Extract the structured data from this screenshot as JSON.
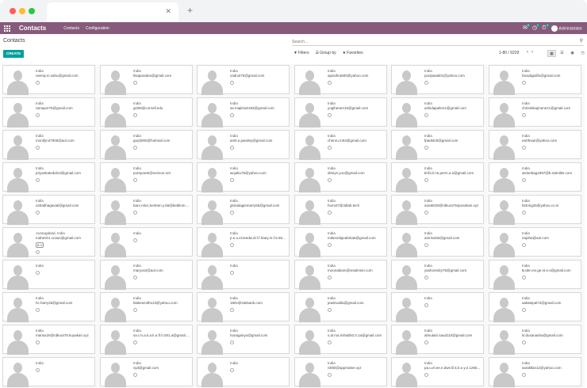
{
  "browser": {
    "tab_close_icon": "close-icon",
    "new_tab_icon": "plus-icon"
  },
  "navbar": {
    "app_title": "Contacts",
    "menu": [
      "Contacts",
      "Configuration"
    ],
    "chat_count": "6",
    "activity_count": "1",
    "timer_count": "4",
    "user": "Administrator",
    "accent": "#875a7b"
  },
  "control_panel": {
    "breadcrumb": "Contacts",
    "search_placeholder": "Search...",
    "create_label": "CREATE",
    "filters_label": "Filters",
    "group_by_label": "Group by",
    "favorites_label": "Favorites",
    "pager": "1-80 / 9229",
    "accent": "#00a09d"
  },
  "cards": [
    [
      {
        "country": "India",
        "email": "neeraj.m.sahu@gmail.com"
      },
      {
        "country": "India",
        "email": "lisaparades@gmail.com"
      },
      {
        "country": "India",
        "email": "vadnol75@gmail.com"
      },
      {
        "country": "India",
        "email": "apasihra500@yahoo.com"
      },
      {
        "country": "India",
        "email": "puripawal01@yahoo.com"
      },
      {
        "country": "India",
        "email": "facadqpdifo@gmail.com"
      }
    ],
    [
      {
        "country": "India",
        "email": "ramayer75@gmail.com"
      },
      {
        "country": "India",
        "email": "gsl39@cornell.edu"
      },
      {
        "country": "India",
        "email": "as.majitria0183@gmail.com"
      },
      {
        "country": "India",
        "email": "yogiheram15@gmail.com"
      },
      {
        "country": "India",
        "email": "ashidajaekm1@gmail.com"
      },
      {
        "country": "India",
        "email": "christiekajmenez1@gmail.com"
      }
    ],
    [
      {
        "country": "India",
        "email": "monifyn47000@aol.com"
      },
      {
        "country": "India",
        "email": "gurj3000@hotmail.com"
      },
      {
        "country": "India",
        "email": "amit.e.pandey@gmail.com"
      },
      {
        "country": "India",
        "email": "chenru.m04@gmail.com"
      },
      {
        "country": "India",
        "email": "fpadstri0@gmail.com"
      },
      {
        "country": "India",
        "email": "earthsair@yahoo.com"
      }
    ],
    [
      {
        "country": "India",
        "email": "priyankatedal13@gmail.com"
      },
      {
        "country": "India",
        "email": "purepoete@verizon.net"
      },
      {
        "country": "India",
        "email": "wcjabu76@yahoo.com"
      },
      {
        "country": "India",
        "email": "dimiye.yoo@gmail.com"
      },
      {
        "country": "India",
        "email": "B.lbi.li.ne.perm.a.s@gmail.com"
      },
      {
        "country": "India",
        "email": "weinebag1997@b.ratmiller.com"
      }
    ],
    [
      {
        "country": "India",
        "email": "ushabhagavati@gmail.com"
      },
      {
        "country": "India",
        "email": "baro.mloc.kenben.y.56@bettilom.com"
      },
      {
        "country": "India",
        "email": "gloriatagiemarry55@gmail.com"
      },
      {
        "country": "India",
        "email": "humi47@3dlab.tech"
      },
      {
        "country": "India",
        "email": "sarak020@rdkura754posekari.xyz"
      },
      {
        "country": "India",
        "email": "birtring26@yahoo.co.in"
      }
    ],
    [
      {
        "country": "Aurangabad, India",
        "email": "mahesh1.crown@gmail.com",
        "tag": "B V"
      },
      {
        "country": "India",
        "email": ""
      },
      {
        "country": "India",
        "email": "p.e.u.el.teedw.di.f.f.haey.re.f.6.65..."
      },
      {
        "country": "India",
        "email": "mikesrdajeabrita8@gmail.com"
      },
      {
        "country": "India",
        "email": "amrisxi65@gmail.com"
      },
      {
        "country": "India",
        "email": "irapiha@aol.com"
      }
    ],
    [
      {
        "country": "India",
        "email": ""
      },
      {
        "country": "India",
        "email": "maryus2@aol.com"
      },
      {
        "country": "India",
        "email": ""
      },
      {
        "country": "India",
        "email": "moonabiam@visalminn.com"
      },
      {
        "country": "India",
        "email": "yashoredzy75@gmail.com"
      },
      {
        "country": "India",
        "email": "B.den.ne.ge.nt.e.s@gmail.com"
      }
    ],
    [
      {
        "country": "India",
        "email": "hc.harry26@gmail.com"
      },
      {
        "country": "India",
        "email": "blakesmith123@yahoo.com"
      },
      {
        "country": "India",
        "email": "180v@sitebank.com"
      },
      {
        "country": "India",
        "email": "jeadnoalla@gmail.com"
      },
      {
        "country": "India",
        "email": ""
      },
      {
        "country": "India",
        "email": "aaliatepal72@gmail.com"
      }
    ],
    [
      {
        "country": "India",
        "email": "marius20@rdkura75.kuyakari.xyz"
      },
      {
        "country": "India",
        "email": "sa.i.m.a.k.a.k.e.ft.h.001.a@gmail.com"
      },
      {
        "country": "India",
        "email": "honaganyo@gmail.com"
      },
      {
        "country": "India",
        "email": "s.al.ma.rishabh0.0.1a@gmail.com"
      },
      {
        "country": "India",
        "email": "almutairi.saud110@gmail.com"
      },
      {
        "country": "India",
        "email": "lir.duxanasha@gmail.com"
      }
    ],
    [
      {
        "country": "India",
        "email": ""
      },
      {
        "country": "India",
        "email": "syd@gmail.com"
      },
      {
        "country": "India",
        "email": ""
      },
      {
        "country": "India",
        "email": "nikhil@appmaker.xyz"
      },
      {
        "country": "India",
        "email": "pa.u.el.ee.e.dwe.lil.k.b.e.y.e.1265..."
      },
      {
        "country": "India",
        "email": "sarakllan12@yahoo.com"
      }
    ]
  ]
}
